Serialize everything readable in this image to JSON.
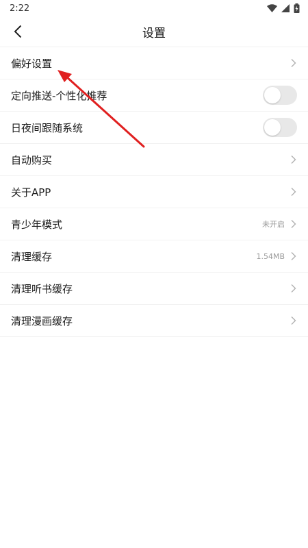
{
  "status_bar": {
    "time": "2:22"
  },
  "header": {
    "title": "设置"
  },
  "settings": [
    {
      "label": "偏好设置",
      "type": "link",
      "value": ""
    },
    {
      "label": "定向推送-个性化推荐",
      "type": "toggle",
      "on": false
    },
    {
      "label": "日夜间跟随系统",
      "type": "toggle",
      "on": false
    },
    {
      "label": "自动购买",
      "type": "link",
      "value": ""
    },
    {
      "label": "关于APP",
      "type": "link",
      "value": ""
    },
    {
      "label": "青少年模式",
      "type": "link",
      "value": "未开启"
    },
    {
      "label": "清理缓存",
      "type": "link",
      "value": "1.54MB"
    },
    {
      "label": "清理听书缓存",
      "type": "link",
      "value": ""
    },
    {
      "label": "清理漫画缓存",
      "type": "link",
      "value": ""
    }
  ],
  "colors": {
    "annotation_arrow": "#e02020",
    "toggle_off": "#e8e8e8",
    "chevron": "#b0b0b0"
  },
  "icons": {
    "back": "chevron-left-icon",
    "row_arrow": "chevron-right-icon",
    "wifi": "wifi-icon",
    "signal": "signal-icon",
    "battery": "battery-charging-icon"
  }
}
